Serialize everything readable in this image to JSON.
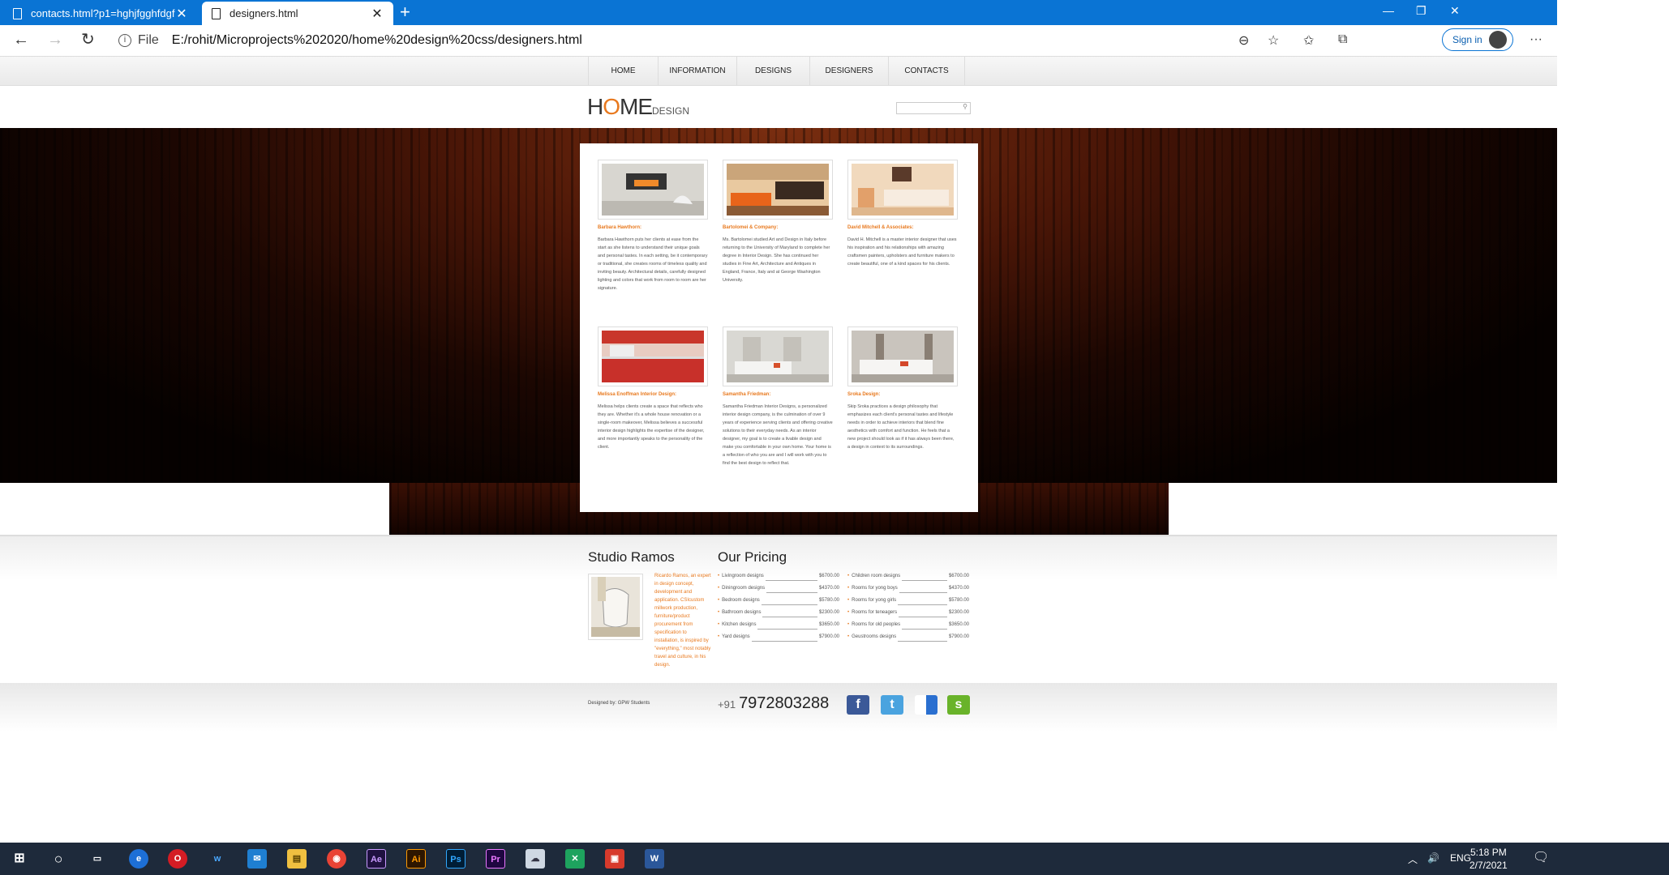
{
  "browser": {
    "tabs": [
      {
        "title": "contacts.html?p1=hghjfgghfdgf",
        "close": "✕"
      },
      {
        "title": "designers.html",
        "close": "✕"
      }
    ],
    "new_tab": "+",
    "window_controls": {
      "minimize": "—",
      "restore": "❐",
      "close": "✕"
    },
    "url_scheme_label": "File",
    "url": "E:/rohit/Microprojects%202020/home%20design%20css/designers.html",
    "sign_in_label": "Sign in",
    "more_label": "···"
  },
  "site": {
    "nav": [
      "HOME",
      "INFORMATION",
      "DESIGNS",
      "DESIGNERS",
      "CONTACTS"
    ],
    "logo": {
      "part1": "H",
      "o": "O",
      "part2": "ME",
      "sub": "DESIGN"
    },
    "designers": [
      {
        "name": "Barbara Hawthorn:",
        "text": "Barbara Hawthorn puts her clients at ease from the start as she listens to understand their unique goals and personal tastes. In each setting, be it contemporary or traditional, she creates rooms of timeless quality and inviting beauty. Architectural details, carefully designed lighting and colors that work from room to room are her signature.",
        "image": "fireplace-room"
      },
      {
        "name": "Bartolomei & Company:",
        "text": "Ms. Bartolomei studied Art and Design in Italy before returning to the University of Maryland to complete her degree in Interior Design. She has continued her studies in Fine Art, Architecture and Antiques in England, France, Italy and at George Washington University.",
        "image": "orange-kitchen"
      },
      {
        "name": "David Mitchell & Associates:",
        "text": "David H. Mitchell is a master interior designer that uses his inspiration and his relationships with amazing craftsmen painters, upholsters and furniture makers to create beautiful, one of a kind spaces for his clients.",
        "image": "beige-lounge"
      },
      {
        "name": "Melissa Enoffman Interior Design:",
        "text": "Melissa helps clients create a space that reflects who they are. Whether it's a whole house renovation or a single-room makeover, Melissa believes a successful interior design highlights the expertise of the designer, and more importantly speaks to the personality of the client.",
        "image": "red-kitchen"
      },
      {
        "name": "Samantha Friedman:",
        "text": "Samantha Friedman Interior Designs, a personalized interior design company, is the culmination of over 9 years of experience serving clients and offering creative solutions to their everyday needs. As an interior designer, my goal is to create a livable design and make you comfortable in your own home. Your home is a reflection of who you are and I will work with you to find the best design to reflect that.",
        "image": "white-living"
      },
      {
        "name": "Sroka Design:",
        "text": "Skip Sroka practices a design philosophy that emphasizes each client's personal tastes and lifestyle needs in order to achieve interiors that blend fine aesthetics with comfort and function. He feels that a new project should look as if it has always been there, a design in context to its surroundings.",
        "image": "white-bedroom"
      }
    ],
    "studio": {
      "title": "Studio Ramos",
      "text": "Ricardo Ramos, an expert in design concept, development and application. CSIcustom millwork production, furniture/product procurement from specification to installation, is inspired by \"everything,\" most notably travel and culture, in his design."
    },
    "pricing": {
      "title": "Our Pricing",
      "left": [
        {
          "item": "Livingroom designs",
          "price": "$6700.00"
        },
        {
          "item": "Diningroom designs",
          "price": "$4370.00"
        },
        {
          "item": "Bedroom designs",
          "price": "$5780.00"
        },
        {
          "item": "Bathroom designs",
          "price": "$2300.00"
        },
        {
          "item": "Kitchen designs",
          "price": "$3650.00"
        },
        {
          "item": "Yard designs",
          "price": "$7900.00"
        }
      ],
      "right": [
        {
          "item": "Children room designs",
          "price": "$6700.00"
        },
        {
          "item": "Rooms for yong boys",
          "price": "$4370.00"
        },
        {
          "item": "Rooms for yong girls",
          "price": "$5780.00"
        },
        {
          "item": "Rooms for teneagers",
          "price": "$2300.00"
        },
        {
          "item": "Rooms for old peoples",
          "price": "$3650.00"
        },
        {
          "item": "Geustrooms designs",
          "price": "$7900.00"
        }
      ]
    },
    "credit": "Designed by: GPW Students",
    "phone_prefix": "+91",
    "phone": "7972803288",
    "social": [
      "facebook",
      "twitter",
      "delicious",
      "stumbleupon"
    ]
  },
  "taskbar": {
    "apps": [
      "windows-start",
      "search-circle",
      "task-view",
      "edge",
      "opera",
      "wavelength",
      "mail",
      "file-explorer",
      "chrome",
      "after-effects",
      "illustrator",
      "photoshop",
      "premiere",
      "cloud",
      "excel-like",
      "presentation",
      "word"
    ],
    "app_labels": {
      "after-effects": "Ae",
      "illustrator": "Ai",
      "photoshop": "Ps",
      "premiere": "Pr",
      "word": "W"
    },
    "lang": "ENG",
    "time": "5:18 PM",
    "date": "2/7/2021"
  },
  "colors": {
    "accent": "#e8791e",
    "browser_blue": "#0a74d4",
    "taskbar": "#1e2a3b"
  }
}
